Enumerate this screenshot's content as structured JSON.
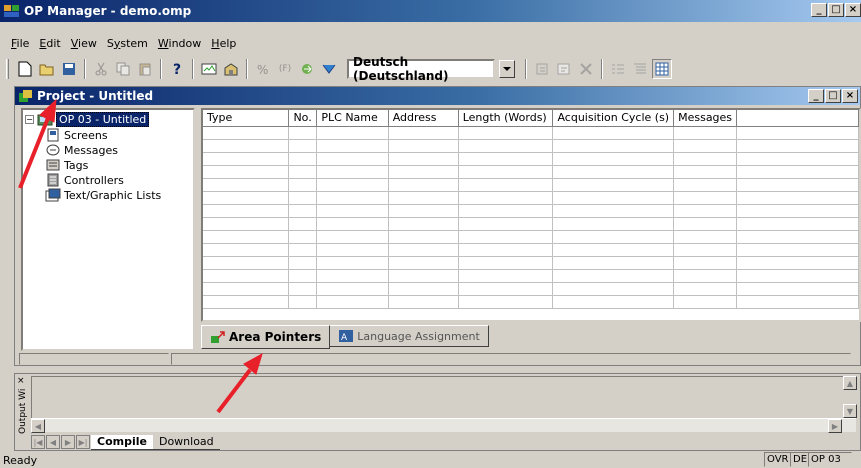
{
  "window": {
    "title": "OP Manager - demo.omp"
  },
  "menu": {
    "items": [
      {
        "accel": "F",
        "rest": "ile"
      },
      {
        "accel": "E",
        "rest": "dit"
      },
      {
        "accel": "V",
        "rest": "iew"
      },
      {
        "pre": "S",
        "accel": "y",
        "rest": "stem"
      },
      {
        "accel": "W",
        "rest": "indow"
      },
      {
        "accel": "H",
        "rest": "elp"
      }
    ]
  },
  "toolbar": {
    "language": "Deutsch (Deutschland)",
    "f_label": "(F)"
  },
  "project": {
    "title": "Project - Untitled",
    "tree": {
      "root": "OP 03 - Untitled",
      "children": [
        "Screens",
        "Messages",
        "Tags",
        "Controllers",
        "Text/Graphic Lists"
      ]
    },
    "table": {
      "columns": [
        "Type",
        "No.",
        "PLC Name",
        "Address",
        "Length (Words)",
        "Acquisition Cycle (s)",
        "Messages"
      ]
    },
    "tabs": [
      "Area Pointers",
      "Language Assignment"
    ]
  },
  "output": {
    "label": "Output Wi",
    "tabs": [
      "Compile",
      "Download"
    ]
  },
  "status": {
    "text": "Ready",
    "ovr": "OVR",
    "lang": "DE",
    "device": "OP 03"
  },
  "colors": {
    "arrow": "#e8202a",
    "title_start": "#0a246a",
    "title_end": "#a6caf0"
  }
}
